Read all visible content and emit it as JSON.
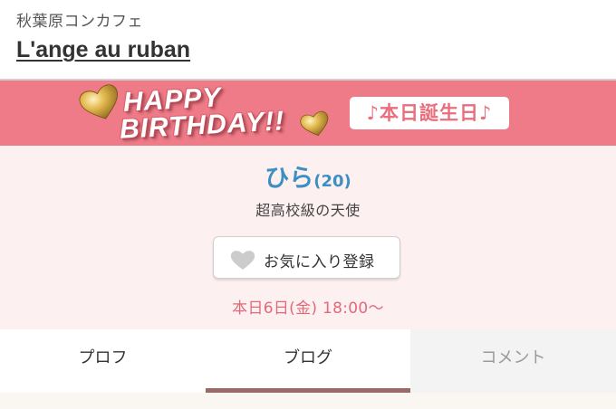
{
  "header": {
    "category": "秋葉原コンカフェ",
    "shop_name": "L'ange au ruban"
  },
  "banner": {
    "happy": "HAPPY",
    "birthday": "BIRTHDAY!!",
    "badge": "♪本日誕生日♪",
    "icons": [
      "gold-heart-icon",
      "gold-heart-icon"
    ],
    "colors": {
      "background": "#ee7b87",
      "badge_text": "#ea6e7d"
    }
  },
  "profile": {
    "name": "ひら",
    "age": "(20)",
    "title": "超高校級の天使",
    "favorite_button": {
      "label": "お気に入り登録",
      "icon": "heart-icon"
    },
    "schedule": "本日6日(金) 18:00〜",
    "colors": {
      "name": "#3e8fc1",
      "schedule": "#e06a79",
      "background": "#fdf0f0"
    }
  },
  "tabs": {
    "items": [
      {
        "label": "プロフ"
      },
      {
        "label": "ブログ"
      },
      {
        "label": "コメント"
      }
    ],
    "active": "ブログ",
    "colors": {
      "active_indicator": "#9b6a66"
    }
  }
}
